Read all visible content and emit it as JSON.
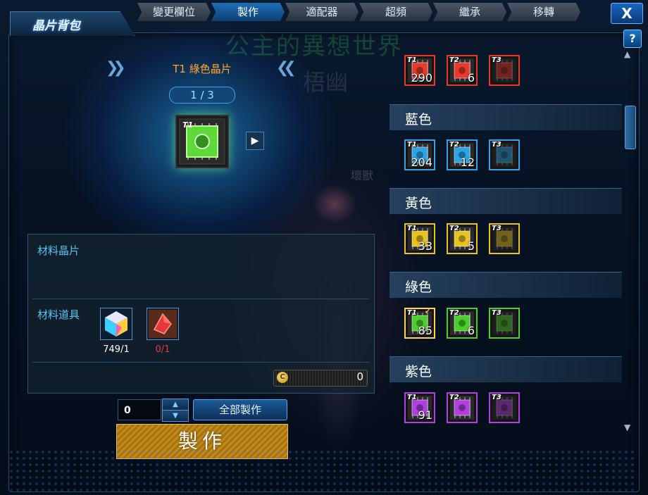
{
  "window": {
    "title": "晶片背包",
    "close_label": "X",
    "help_label": "?"
  },
  "tabs": [
    {
      "label": "變更欄位",
      "active": false
    },
    {
      "label": "製作",
      "active": true
    },
    {
      "label": "適配器",
      "active": false
    },
    {
      "label": "超頻",
      "active": false
    },
    {
      "label": "繼承",
      "active": false
    },
    {
      "label": "移轉",
      "active": false
    }
  ],
  "background_text": {
    "line1": "公主的異想世界",
    "line2": "梧幽",
    "line3": "壞獸"
  },
  "craft": {
    "recipe_name": "T1 綠色晶片",
    "page": "1 / 3",
    "chip_color": "#5fd83a",
    "materials_chip_label": "材料晶片",
    "materials_item_label": "材料道具",
    "items": [
      {
        "icon": "prism-cube-icon",
        "count": "749/1",
        "count_color": "#ffffff"
      },
      {
        "icon": "red-crystal-icon",
        "count": "0/1",
        "count_color": "#e23a3a"
      }
    ],
    "coin_symbol": "C",
    "coin_value": "0",
    "quantity": "0",
    "craft_all_label": "全部製作",
    "craft_label": "製作"
  },
  "chip_groups": [
    {
      "name": "",
      "color": "#e8392a",
      "chips": [
        {
          "tier": "T1",
          "count": "290"
        },
        {
          "tier": "T2",
          "count": "6"
        },
        {
          "tier": "T3",
          "count": ""
        }
      ]
    },
    {
      "name": "藍色",
      "color": "#2ea4e8",
      "chips": [
        {
          "tier": "T1",
          "count": "204"
        },
        {
          "tier": "T2",
          "count": "12"
        },
        {
          "tier": "T3",
          "count": ""
        }
      ]
    },
    {
      "name": "黃色",
      "color": "#e8c21e",
      "chips": [
        {
          "tier": "T1",
          "count": "33"
        },
        {
          "tier": "T2",
          "count": "5"
        },
        {
          "tier": "T3",
          "count": ""
        }
      ]
    },
    {
      "name": "綠色",
      "color": "#4ccf2e",
      "chips": [
        {
          "tier": "T1",
          "count": "85"
        },
        {
          "tier": "T2",
          "count": "6"
        },
        {
          "tier": "T3",
          "count": ""
        }
      ]
    },
    {
      "name": "紫色",
      "color": "#b03ee0",
      "chips": [
        {
          "tier": "T1",
          "count": "91"
        },
        {
          "tier": "T2",
          "count": ""
        },
        {
          "tier": "T3",
          "count": ""
        }
      ]
    }
  ],
  "scroll": {
    "up": "▲",
    "down": "▼"
  }
}
